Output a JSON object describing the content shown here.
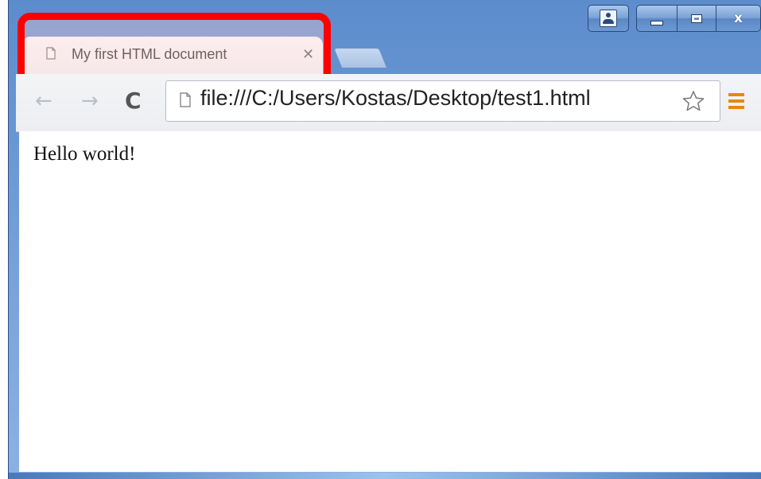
{
  "window": {
    "caption_buttons": [
      {
        "name": "profile",
        "icon": "profile-icon"
      },
      {
        "name": "minimize",
        "icon": "minimize-icon"
      },
      {
        "name": "maximize",
        "icon": "maximize-icon"
      },
      {
        "name": "close",
        "label": "x",
        "icon": "close-icon"
      }
    ],
    "accent_color": "#6f9bd6"
  },
  "tabs": [
    {
      "title": "My first HTML document",
      "close_glyph": "✕",
      "icon": "page-icon",
      "active": true
    }
  ],
  "annotation": {
    "color": "#ff0000",
    "target": "active-tab"
  },
  "toolbar": {
    "back_glyph": "←",
    "forward_glyph": "→",
    "reload_glyph": "C",
    "url": "file:///C:/Users/Kostas/Desktop/test1.html",
    "bookmark_icon": "star-icon",
    "menu_icon": "menu-icon",
    "menu_color": "#e28a10"
  },
  "page": {
    "text": "Hello world!"
  }
}
